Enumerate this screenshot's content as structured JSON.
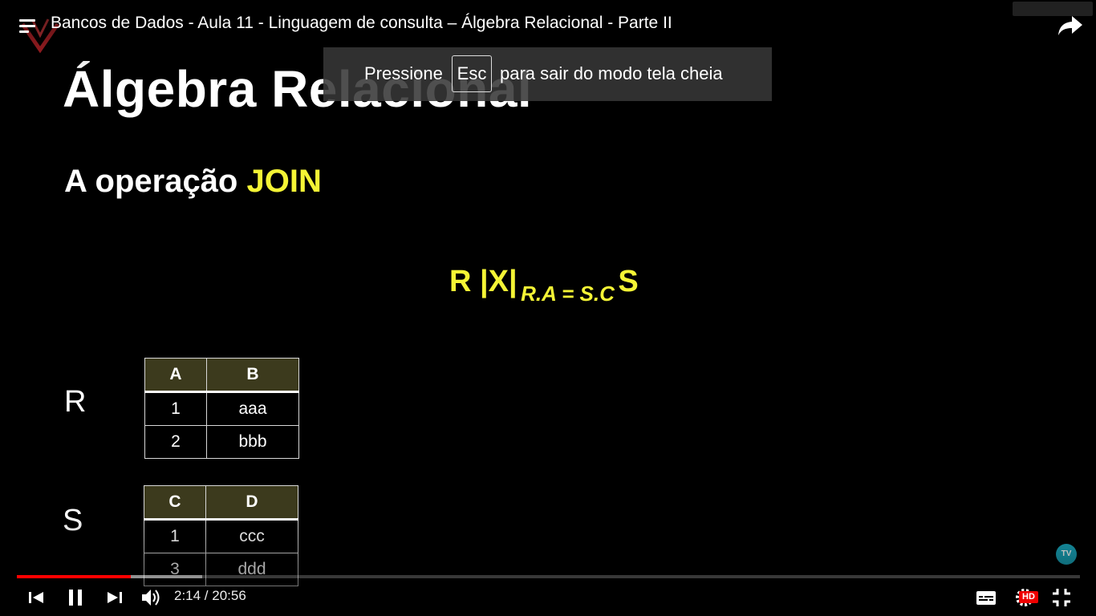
{
  "header": {
    "title": "Bancos de Dados - Aula 11 - Linguagem de consulta – Álgebra Relacional - Parte II"
  },
  "toast": {
    "prefix": "Pressione",
    "key": "Esc",
    "suffix": "para sair do modo tela cheia"
  },
  "slide": {
    "title": "Álgebra Relacional",
    "subtitle_prefix": "A operação",
    "subtitle_highlight": "JOIN",
    "formula": {
      "left": "R |X|",
      "condition": "R.A = S.C",
      "right": "S"
    },
    "relation_r": {
      "label": "R",
      "headers": [
        "A",
        "B"
      ],
      "rows": [
        [
          "1",
          "aaa"
        ],
        [
          "2",
          "bbb"
        ]
      ]
    },
    "relation_s": {
      "label": "S",
      "headers": [
        "C",
        "D"
      ],
      "rows": [
        [
          "1",
          "ccc"
        ],
        [
          "3",
          "ddd"
        ]
      ]
    }
  },
  "player": {
    "time": "2:14 / 20:56",
    "progress_played": 0.107,
    "progress_buffered": 0.174,
    "quality_badge": "HD",
    "watermark": "TV",
    "accent_color": "#ff0000"
  }
}
